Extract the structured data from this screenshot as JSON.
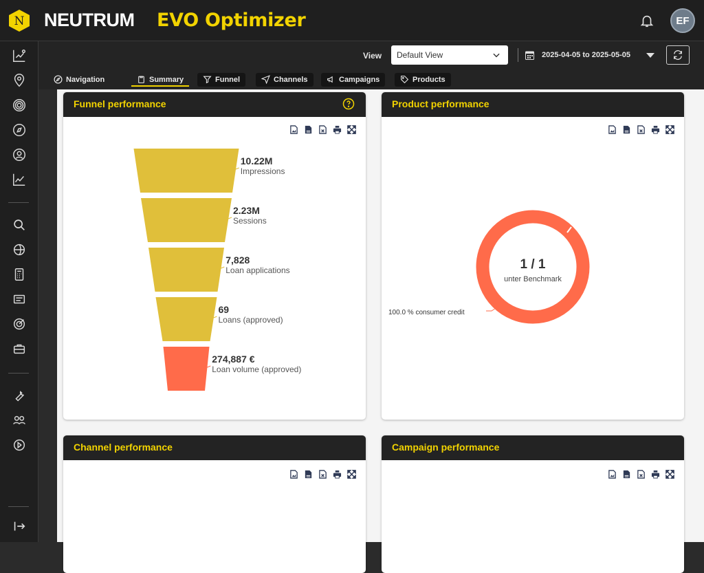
{
  "header": {
    "brand": "NEUTRUM",
    "product": "EVO Optimizer",
    "logo_letter": "N",
    "user_initials": "EF"
  },
  "sidebar": {
    "icons": [
      "analytics-icon",
      "location-icon",
      "target-icon",
      "compass-icon",
      "user-search-icon",
      "trend-icon",
      "search-icon",
      "globe-icon",
      "calculator-icon",
      "list-icon",
      "goal-icon",
      "briefcase-icon",
      "wrench-icon",
      "users-icon",
      "play-icon",
      "collapse-icon"
    ]
  },
  "controls": {
    "view_label": "View",
    "view_value": "Default View",
    "date_range": "2025-04-05 to 2025-05-05"
  },
  "tabs": [
    {
      "label": "Navigation",
      "icon": "compass-icon"
    },
    {
      "label": "Summary",
      "icon": "clipboard-icon"
    },
    {
      "label": "Funnel",
      "icon": "filter-icon"
    },
    {
      "label": "Channels",
      "icon": "send-icon"
    },
    {
      "label": "Campaigns",
      "icon": "megaphone-icon"
    },
    {
      "label": "Products",
      "icon": "tag-icon"
    }
  ],
  "cards": {
    "funnel": {
      "title": "Funnel performance"
    },
    "product": {
      "title": "Product performance"
    },
    "channel": {
      "title": "Channel performance"
    },
    "campaign": {
      "title": "Campaign performance"
    }
  },
  "tool_icons": [
    "image-export-icon",
    "pdf-export-icon",
    "excel-export-icon",
    "print-icon",
    "fullscreen-icon"
  ],
  "chart_data": [
    {
      "type": "funnel",
      "stages": [
        {
          "value": "10.22M",
          "label": "Impressions",
          "color": "#e0bf3a"
        },
        {
          "value": "2.23M",
          "label": "Sessions",
          "color": "#e0bf3a"
        },
        {
          "value": "7,828",
          "label": "Loan applications",
          "color": "#e0bf3a"
        },
        {
          "value": "69",
          "label": "Loans (approved)",
          "color": "#e0bf3a"
        },
        {
          "value": "274,887 €",
          "label": "Loan volume (approved)",
          "color": "#ff6b4a"
        }
      ]
    },
    {
      "type": "pie",
      "center_value": "1 / 1",
      "center_label": "unter Benchmark",
      "slices": [
        {
          "label": "100.0 % consumer credit",
          "value": 100,
          "color": "#ff6b4a"
        }
      ]
    }
  ]
}
